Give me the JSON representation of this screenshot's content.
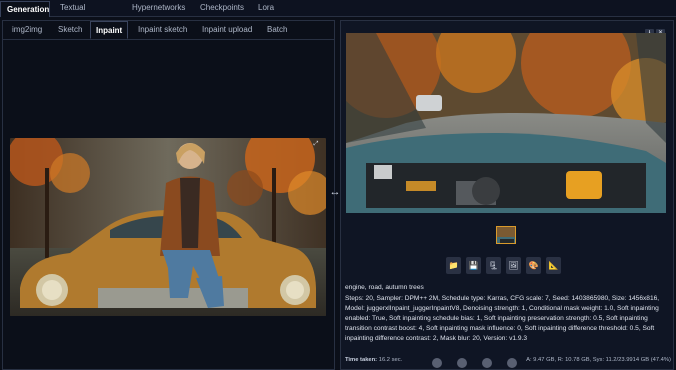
{
  "top_tabs": [
    {
      "label": "Generation",
      "active": true
    },
    {
      "label": "Textual Inversion",
      "active": false
    },
    {
      "label": "Hypernetworks",
      "active": false
    },
    {
      "label": "Checkpoints",
      "active": false
    },
    {
      "label": "Lora",
      "active": false
    }
  ],
  "sub_tabs": [
    {
      "label": "img2img",
      "active": false
    },
    {
      "label": "Sketch",
      "active": false
    },
    {
      "label": "Inpaint",
      "active": true
    },
    {
      "label": "Inpaint sketch",
      "active": false
    },
    {
      "label": "Inpaint upload",
      "active": false
    },
    {
      "label": "Batch",
      "active": false
    }
  ],
  "canvas_tool_icon": "⤢",
  "splitter_icon": "↔",
  "corner_buttons": [
    "⭳",
    "✕"
  ],
  "action_icons": [
    "folder-icon",
    "save-icon",
    "zip-icon",
    "image-icon",
    "palette-icon",
    "ruler-icon"
  ],
  "action_glyphs": [
    "📁",
    "💾",
    "🗜",
    "🖼",
    "🎨",
    "📐"
  ],
  "output": {
    "prompt": "engine, road, autumn trees",
    "params": "Steps: 20, Sampler: DPM++ 2M, Schedule type: Karras, CFG scale: 7, Seed: 1403865980, Size: 1456x816, Model: juggerxlInpaint_juggerInpaintV8, Denoising strength: 1, Conditional mask weight: 1.0, Soft inpainting enabled: True, Soft inpainting schedule bias: 1, Soft inpainting preservation strength: 0.5, Soft inpainting transition contrast boost: 4, Soft inpainting mask influence: 0, Soft inpainting difference threshold: 0.5, Soft inpainting difference contrast: 2, Mask blur: 20, Version: v1.9.3"
  },
  "footer": {
    "time_label": "Time taken:",
    "time_value": "16.2 sec.",
    "vram": "A: 9.47 GB, R: 10.78 GB, Sys: 11.2/23.9914 GB (47.4%)"
  },
  "colors": {
    "background": "#0b0f19",
    "panel": "#0f1524",
    "accent": "#d99a2b"
  }
}
